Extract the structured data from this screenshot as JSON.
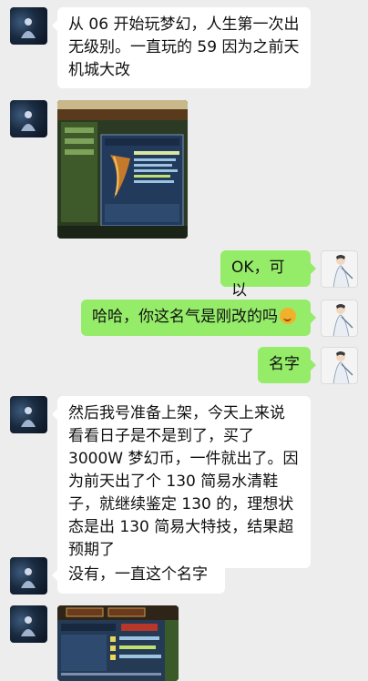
{
  "messages": [
    {
      "side": "left",
      "type": "text",
      "text": "从 06 开始玩梦幻，人生第一次出无级别。一直玩的 59 因为之前天机城大改"
    },
    {
      "side": "left",
      "type": "image",
      "icon": "game-screenshot-equipment"
    },
    {
      "side": "right",
      "type": "text",
      "text": "OK，可以"
    },
    {
      "side": "right",
      "type": "text",
      "text": "哈哈，你这名气是刚改的吗",
      "emoji": "thinking-face"
    },
    {
      "side": "right",
      "type": "text",
      "text": "名字"
    },
    {
      "side": "left",
      "type": "text",
      "text": "然后我号准备上架，今天上来说看看日子是不是到了，买了 3000W 梦幻币，一件就出了。因为前天出了个 130 简易水清鞋子，就继续鉴定 130 的，理想状态是出 130 简易大特技，结果超预期了"
    },
    {
      "side": "left",
      "type": "text",
      "text": "没有，一直这个名字"
    },
    {
      "side": "left",
      "type": "image",
      "icon": "game-screenshot-character"
    }
  ],
  "colors": {
    "background": "#ededed",
    "bubble_left": "#ffffff",
    "bubble_right": "#95ec69"
  }
}
